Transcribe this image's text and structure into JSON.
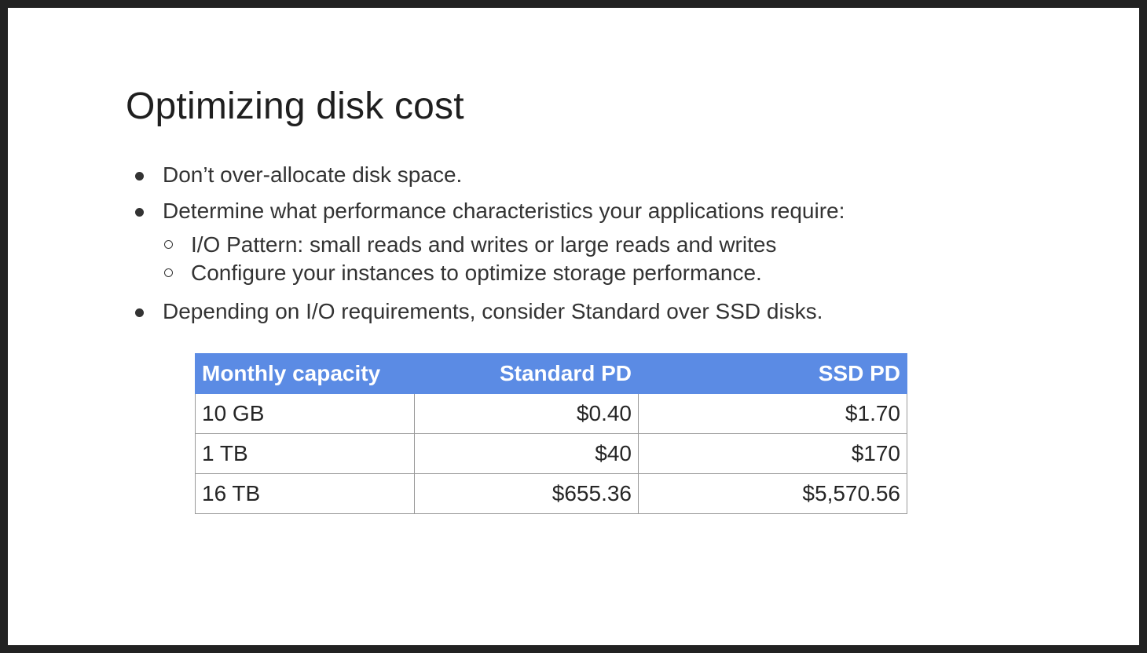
{
  "slide": {
    "title": "Optimizing disk cost",
    "bullets": [
      "Don’t over-allocate disk space.",
      "Determine what performance characteristics your applications require:",
      "Depending on I/O requirements, consider Standard over SSD disks."
    ],
    "sub_bullets": [
      "I/O Pattern: small reads and writes or large reads and writes",
      "Configure your instances to optimize storage performance."
    ]
  },
  "table": {
    "headers": [
      "Monthly capacity",
      "Standard PD",
      "SSD PD"
    ],
    "rows": [
      [
        "10 GB",
        "$0.40",
        "$1.70"
      ],
      [
        "1 TB",
        "$40",
        "$170"
      ],
      [
        "16 TB",
        "$655.36",
        "$5,570.56"
      ]
    ],
    "header_color": "#5b8be4"
  }
}
